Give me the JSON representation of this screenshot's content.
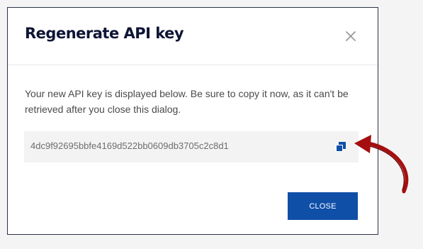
{
  "dialog": {
    "title": "Regenerate API key",
    "close_icon": "close-icon",
    "message": "Your new API key is displayed below. Be sure to copy it now, as it can't be retrieved after you close this dialog.",
    "api_key": "4dc9f92695bbfe4169d522bb0609db3705c2c8d1",
    "copy_icon": "copy-icon",
    "close_button_label": "CLOSE"
  },
  "annotation": {
    "arrow_icon": "curved-arrow-icon",
    "arrow_color": "#a50f0f"
  },
  "colors": {
    "primary_button": "#0f4fa8",
    "title_text": "#0f1535",
    "key_box_background": "#f3f3f3"
  }
}
